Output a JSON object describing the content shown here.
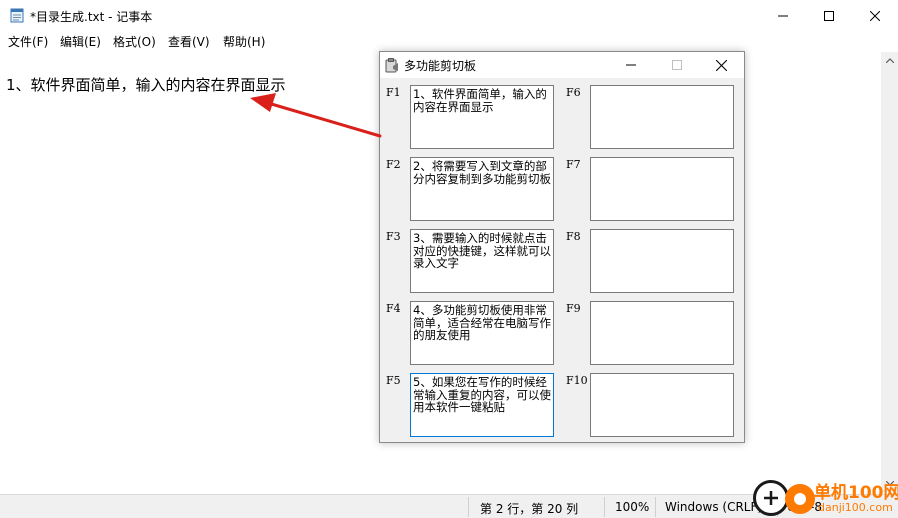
{
  "notepad": {
    "title": "*目录生成.txt - 记事本",
    "menu": [
      "文件(F)",
      "编辑(E)",
      "格式(O)",
      "查看(V)",
      "帮助(H)"
    ],
    "content": "1、软件界面简单，输入的内容在界面显示",
    "status": {
      "position": "第 2 行，第 20 列",
      "zoom": "100%",
      "encoding": "Windows (CRLF)",
      "charset": "UTF-8"
    }
  },
  "clipboard": {
    "title": "多功能剪切板",
    "slots": [
      {
        "key": "F1",
        "text": "1、软件界面简单，输入的内容在界面显示"
      },
      {
        "key": "F2",
        "text": "2、将需要写入到文章的部分内容复制到多功能剪切板"
      },
      {
        "key": "F3",
        "text": "3、需要输入的时候就点击对应的快捷键，这样就可以录入文字"
      },
      {
        "key": "F4",
        "text": "4、多功能剪切板使用非常简单，适合经常在电脑写作的朋友使用"
      },
      {
        "key": "F5",
        "text": "5、如果您在写作的时候经常输入重复的内容，可以使用本软件一键粘贴"
      },
      {
        "key": "F6",
        "text": ""
      },
      {
        "key": "F7",
        "text": ""
      },
      {
        "key": "F8",
        "text": ""
      },
      {
        "key": "F9",
        "text": ""
      },
      {
        "key": "F10",
        "text": ""
      }
    ]
  },
  "watermark": {
    "line1": "单机100网",
    "line2": "danji100.com"
  },
  "colors": {
    "arrow": "#d9201a",
    "focus_border": "#0078d7",
    "watermark": "#ff7a00"
  },
  "icons": [
    "notepad-icon",
    "minimize-icon",
    "maximize-icon",
    "close-icon",
    "clipboard-app-icon",
    "scroll-up-icon",
    "scroll-down-icon"
  ]
}
